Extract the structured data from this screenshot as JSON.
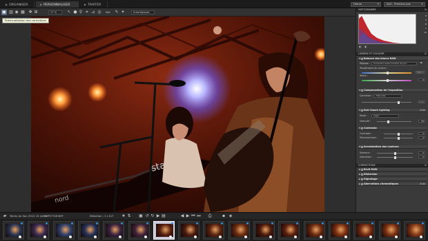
{
  "tabs": [
    {
      "label": "ORGANISER",
      "active": false
    },
    {
      "label": "PERSONNALISER",
      "active": true
    },
    {
      "label": "TRAITER",
      "active": false
    }
  ],
  "topright": {
    "workspace": "Harmo",
    "preset": "DxO - Premiers pas"
  },
  "toolbar": {
    "zoom": "27 %",
    "mode_label": "N/A",
    "autoplace": "Autoréglages"
  },
  "tooltip": "Prévisualisation des corrections",
  "panel": {
    "histogram": {
      "title": "HISTOGRAMME",
      "rows": [
        "R",
        "V",
        "B",
        "L",
        "10"
      ]
    },
    "light_color": {
      "title": "LUMIÈRE ET COULEUR"
    },
    "white_balance": {
      "title": "Balance des blancs RAW",
      "setting_label": "Réglage :",
      "setting_value": "Correction selon lumière du jour",
      "temp_label": "Température de couleur :",
      "temp_value": "5300 K",
      "tint_label": "Teinte :",
      "tint_value": "0"
    },
    "exposure": {
      "title": "Compensation de l'exposition",
      "correction_label": "Correction :",
      "correction_value": "Manuelle",
      "value": "1,41"
    },
    "smart_lighting": {
      "title": "DxO Smart Lighting",
      "right": "Auto",
      "mode_label": "Mode :",
      "mode_value": "Léger",
      "intensity_label": "Intensité :",
      "intensity_value": "30"
    },
    "contrast": {
      "title": "Contraste",
      "contrast_label": "Contraste :",
      "contrast_value": "0",
      "micro_label": "Microcontraste :",
      "micro_value": "0"
    },
    "color_accent": {
      "title": "Accentuation des couleurs",
      "vibrance_label": "Vibrance :",
      "vibrance_value": "0",
      "saturation_label": "Saturation :",
      "saturation_value": "0"
    },
    "corrections": {
      "title": "CORRECTIONS",
      "items": [
        {
          "label": "Bruit RAW",
          "right": ""
        },
        {
          "label": "Distorsion",
          "right": ""
        },
        {
          "label": "Vignetage",
          "right": ""
        },
        {
          "label": "Aberrations chromatiques",
          "right": "Auto"
        }
      ]
    }
  },
  "filmstrip": {
    "folder": "Terres du Son 2012 15 juillet",
    "filename": "20P37749.NEF",
    "selection": "Sélection : 1 / 417",
    "thumb_count": 17,
    "selected_index": 6
  },
  "colors": {
    "accent": "#5a6a86",
    "badge": "#3b8ed4",
    "stage_red": "#c7321a"
  }
}
